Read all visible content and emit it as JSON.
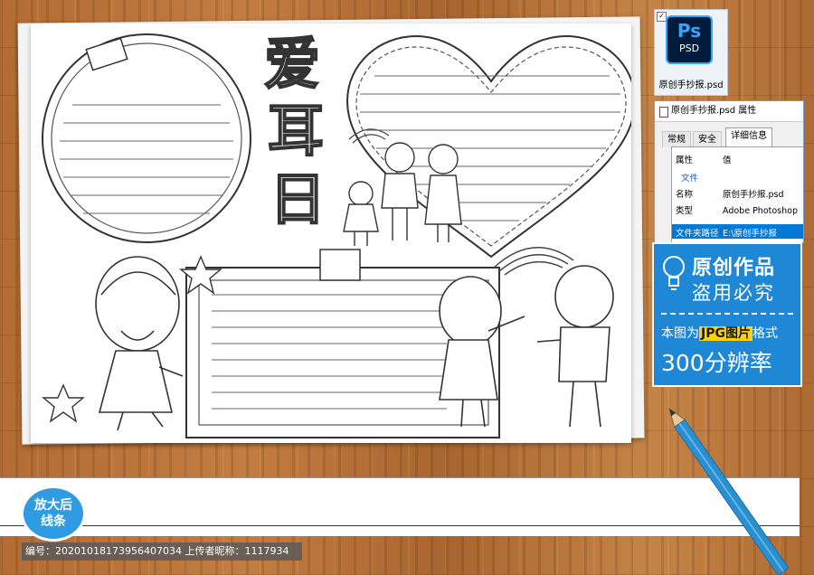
{
  "poster": {
    "title_chars": [
      "爱",
      "耳",
      "日"
    ]
  },
  "psd_file": {
    "icon_top": "Ps",
    "icon_bottom": "PSD",
    "filename": "原创手抄报.psd"
  },
  "properties_dialog": {
    "title": "原创手抄报.psd 属性",
    "tabs": [
      "常规",
      "安全",
      "详细信息"
    ],
    "active_tab": "详细信息",
    "header_property": "属性",
    "header_value": "值",
    "section": "文件",
    "rows": [
      {
        "key": "名称",
        "value": "原创手抄报.psd"
      },
      {
        "key": "类型",
        "value": "Adobe Photoshop"
      },
      {
        "key": "文件夹路径",
        "value": "E:\\原创手抄报"
      }
    ]
  },
  "promo": {
    "line1": "原创作品",
    "line2": "盗用必究",
    "line3_prefix": "本图为",
    "line3_highlight": "JPG图片",
    "line3_suffix": "格式",
    "line4": "300分辨率"
  },
  "enlarge_badge": {
    "line1": "放大后",
    "line2": "线条"
  },
  "footer": {
    "text": "编号：20201018173956407034 上传者昵称：1117934"
  },
  "colors": {
    "accent_blue": "#1e88d6",
    "highlight_yellow": "#ffd400",
    "wood": "#b8733a"
  }
}
